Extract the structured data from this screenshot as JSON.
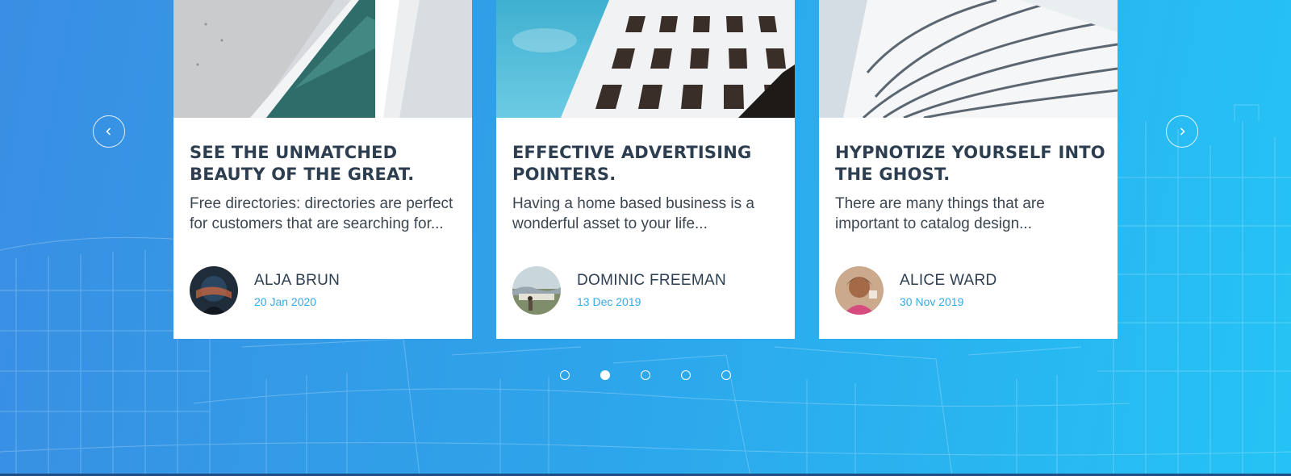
{
  "carousel": {
    "prev_icon": "chevron-left-icon",
    "next_icon": "chevron-right-icon",
    "active_dot": 1,
    "dot_count": 5
  },
  "cards": [
    {
      "title": "SEE THE UNMATCHED BEAUTY OF THE GREAT.",
      "excerpt": "Free directories: directories are perfect for customers that are searching for...",
      "author": "ALJA BRUN",
      "date": "20 Jan 2020"
    },
    {
      "title": "EFFECTIVE ADVERTISING POINTERS.",
      "excerpt": "Having a home based business is a wonderful asset to your life...",
      "author": "DOMINIC FREEMAN",
      "date": "13 Dec 2019"
    },
    {
      "title": "HYPNOTIZE YOURSELF INTO THE GHOST.",
      "excerpt": "There are many things that are important to catalog design...",
      "author": "ALICE WARD",
      "date": "30 Nov 2019"
    }
  ],
  "colors": {
    "background_start": "#3a8ee3",
    "background_end": "#25c3f5",
    "title": "#2c3e50",
    "date": "#35a9e6"
  }
}
